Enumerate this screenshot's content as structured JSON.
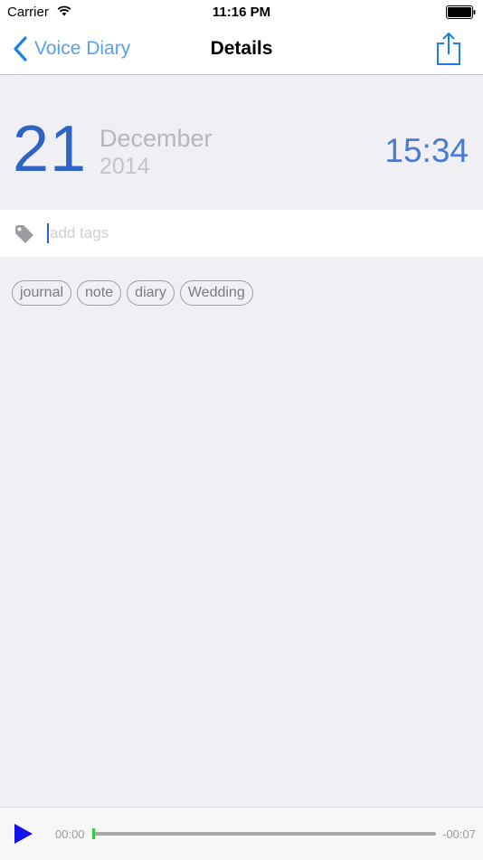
{
  "status_bar": {
    "carrier": "Carrier",
    "time": "11:16 PM"
  },
  "nav": {
    "back_label": "Voice Diary",
    "title": "Details",
    "share_icon": "share-icon"
  },
  "entry": {
    "day": "21",
    "month": "December",
    "year": "2014",
    "time": "15:34"
  },
  "tag_input": {
    "placeholder": "add tags",
    "value": ""
  },
  "tags": [
    "journal",
    "note",
    "diary",
    "Wedding"
  ],
  "player": {
    "elapsed": "00:00",
    "remaining": "-00:07",
    "progress": 0.0
  },
  "colors": {
    "accent_blue": "#2f64c4",
    "link_blue": "#5aa0ea",
    "progress_green": "#2fcf3f",
    "play_blue": "#1414e6",
    "background": "#efeff4"
  }
}
